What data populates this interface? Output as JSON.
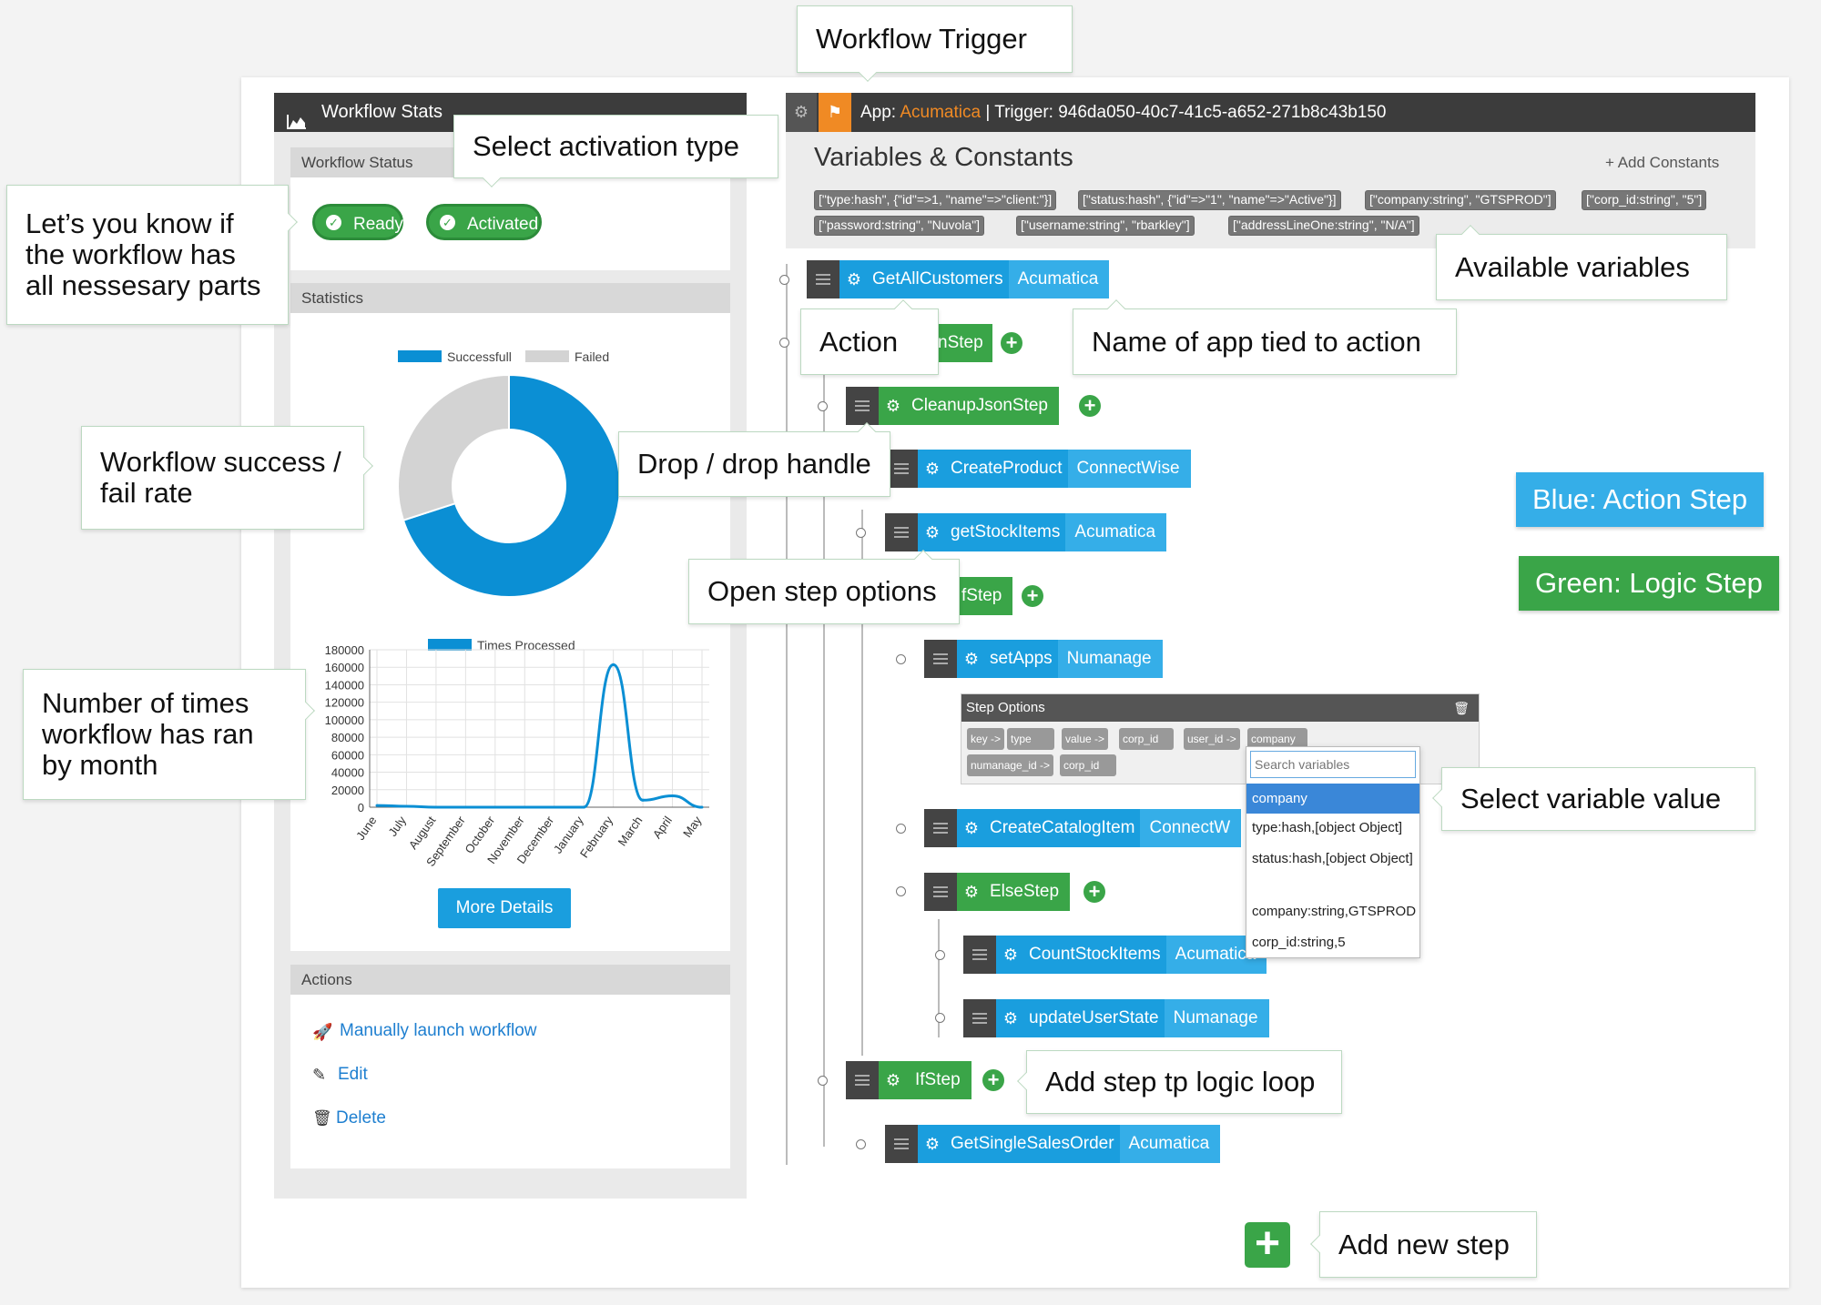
{
  "stats_panel": {
    "title": "Workflow Stats",
    "status_section": "Workflow Status",
    "ready": "Ready",
    "activated": "Activated",
    "statistics_section": "Statistics",
    "actions_section": "Actions",
    "more_details": "More Details",
    "actions": [
      "Manually launch workflow",
      "Edit",
      "Delete"
    ]
  },
  "chart_data": [
    {
      "type": "pie",
      "donut": true,
      "labels": [
        "Successfull",
        "Failed"
      ],
      "values": [
        70,
        30
      ],
      "colors": [
        "#0b8fd4",
        "#d3d3d3"
      ],
      "legend": "top"
    },
    {
      "type": "line",
      "series": [
        {
          "name": "Times Processed",
          "values": [
            2000,
            1000,
            0,
            0,
            0,
            0,
            0,
            0,
            163000,
            8000,
            13000,
            0
          ]
        }
      ],
      "categories": [
        "June",
        "July",
        "August",
        "September",
        "October",
        "November",
        "December",
        "January",
        "February",
        "March",
        "April",
        "May"
      ],
      "ylim": [
        0,
        180000
      ],
      "yticks": [
        "180000",
        "160000",
        "140000",
        "120000",
        "100000",
        "80000",
        "60000",
        "40000",
        "20000",
        "0"
      ],
      "grid": true,
      "color": "#0b8fd4"
    }
  ],
  "workflow": {
    "app_label": "App:",
    "app_name": "Acumatica",
    "separator": "|",
    "trigger_label": "Trigger:",
    "trigger_id": "946da050-40c7-41c5-a652-271b8c43b150",
    "variables_title": "Variables & Constants",
    "add_constants": "+ Add Constants",
    "variables": [
      "[\"type:hash\", {\"id\"=>1, \"name\"=>\"client:\"}]",
      "[\"status:hash\", {\"id\"=>\"1\", \"name\"=>\"Active\"}]",
      "[\"company:string\", \"GTSPROD\"]",
      "[\"corp_id:string\", \"5\"]",
      "[\"password:string\", \"Nuvola\"]",
      "[\"username:string\", \"rbarkley\"]",
      "[\"addressLineOne:string\", \"N/A\"]"
    ],
    "steps": [
      {
        "name": "GetAllCustomers",
        "app": "Acumatica"
      },
      {
        "name": "nStep",
        "app": ""
      },
      {
        "name": "CleanupJsonStep",
        "app": ""
      },
      {
        "name": "CreateProduct",
        "app": "ConnectWise"
      },
      {
        "name": "getStockItems",
        "app": "Acumatica"
      },
      {
        "name": "fStep",
        "app": ""
      },
      {
        "name": "setApps",
        "app": "Numanage"
      },
      {
        "name": "CreateCatalogItem",
        "app": "ConnectW"
      },
      {
        "name": "ElseStep",
        "app": ""
      },
      {
        "name": "CountStockItems",
        "app": "Acumatica"
      },
      {
        "name": "updateUserState",
        "app": "Numanage"
      },
      {
        "name": "IfStep",
        "app": ""
      },
      {
        "name": "GetSingleSalesOrder",
        "app": "Acumatica"
      }
    ],
    "step_options": {
      "title": "Step Options",
      "chips": [
        "key ->",
        "type",
        "value ->",
        "corp_id",
        "user_id ->",
        "company",
        "numanage_id ->",
        "corp_id"
      ],
      "search_placeholder": "Search variables",
      "options": [
        "company",
        "type:hash,[object Object]",
        "status:hash,[object Object]",
        "company:string,GTSPROD",
        "corp_id:string,5"
      ]
    }
  },
  "callouts": {
    "trigger": "Workflow Trigger",
    "activation": "Select activation type",
    "lets_know": "Let’s you know if the workflow has all nessesary parts",
    "success_rate": "Workflow success / fail rate",
    "times_ran": "Number of times workflow has ran by month",
    "available_vars": "Available variables",
    "action": "Action",
    "app_name": "Name of app tied to action",
    "drop": "Drop / drop handle",
    "open_opts": "Open step options",
    "select_var": "Select variable value",
    "add_logic": "Add step tp logic loop",
    "add_new": "Add new step",
    "blue": "Blue: Action Step",
    "green": "Green: Logic Step"
  },
  "colors": {
    "action": "#1a9ede",
    "logic": "#3aa548",
    "trigger": "#f08a24"
  }
}
